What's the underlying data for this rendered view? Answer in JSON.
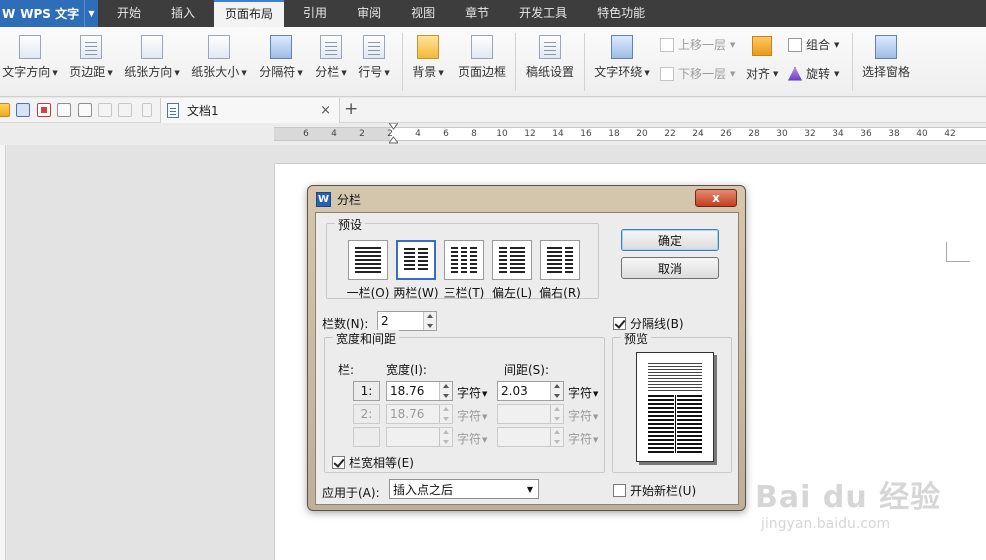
{
  "app": {
    "title": "WPS 文字",
    "logo": "W"
  },
  "menu": [
    {
      "label": "开始"
    },
    {
      "label": "插入"
    },
    {
      "label": "页面布局",
      "active": true
    },
    {
      "label": "引用"
    },
    {
      "label": "审阅"
    },
    {
      "label": "视图"
    },
    {
      "label": "章节"
    },
    {
      "label": "开发工具"
    },
    {
      "label": "特色功能"
    }
  ],
  "ribbon": {
    "text_direction": "文字方向",
    "margins": "页边距",
    "orientation": "纸张方向",
    "paper_size": "纸张大小",
    "breaks": "分隔符",
    "columns": "分栏",
    "line_numbers": "行号",
    "background": "背景",
    "page_border": "页面边框",
    "manuscript": "稿纸设置",
    "wrap_text": "文字环绕",
    "bring_forward": "上移一层",
    "send_backward": "下移一层",
    "group": "组合",
    "align": "对齐",
    "rotate": "旋转",
    "selection_pane": "选择窗格"
  },
  "tabs": {
    "document": "文档1",
    "close": "×",
    "new": "+"
  },
  "ruler": {
    "ticks": [
      "6",
      "4",
      "2",
      "2",
      "4",
      "6",
      "8",
      "10",
      "12",
      "14",
      "16",
      "18",
      "20",
      "22",
      "24",
      "26",
      "28",
      "30",
      "32",
      "34",
      "36",
      "38",
      "40",
      "42"
    ]
  },
  "dialog": {
    "icon": "W",
    "title": "分栏",
    "close": "x",
    "presets_label": "预设",
    "presets": [
      {
        "label": "一栏(O)",
        "cols": 1
      },
      {
        "label": "两栏(W)",
        "cols": 2,
        "selected": true
      },
      {
        "label": "三栏(T)",
        "cols": 3
      },
      {
        "label": "偏左(L)",
        "cols": 2
      },
      {
        "label": "偏右(R)",
        "cols": 2
      }
    ],
    "ok": "确定",
    "cancel": "取消",
    "col_count_label": "栏数(N):",
    "col_count_value": "2",
    "separator_label": "分隔线(B)",
    "separator_checked": true,
    "width_spacing_label": "宽度和间距",
    "col_header": "栏:",
    "width_header": "宽度(I):",
    "spacing_header": "间距(S):",
    "unit": "字符",
    "rows": [
      {
        "index": "1:",
        "width": "18.76",
        "spacing": "2.03",
        "enabled": true
      },
      {
        "index": "2:",
        "width": "18.76",
        "spacing": "",
        "enabled": false
      },
      {
        "index": "",
        "width": "",
        "spacing": "",
        "enabled": false
      }
    ],
    "equal_width_label": "栏宽相等(E)",
    "equal_width_checked": true,
    "preview_label": "预览",
    "apply_to_label": "应用于(A):",
    "apply_to_value": "插入点之后",
    "new_column_label": "开始新栏(U)",
    "new_column_checked": false
  },
  "watermark": {
    "main": "Bai du 经验",
    "sub": "jingyan.baidu.com"
  },
  "colors": {
    "accent": "#2e6db8",
    "menubar": "#3d3d3d",
    "dialog_frame": "#c9bca3"
  }
}
